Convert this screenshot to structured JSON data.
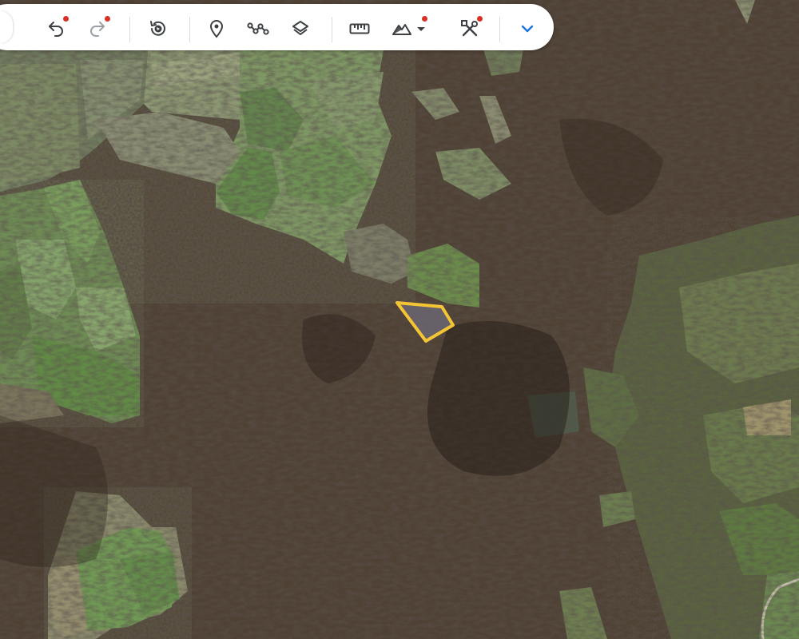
{
  "map": {
    "view": "satellite",
    "parcel_outline_color": "#f3c534",
    "parcel_fill_color": "#6e6a7a"
  },
  "toolbar": {
    "buttons": [
      {
        "name": "undo",
        "icon": "undo-icon",
        "badge": true
      },
      {
        "name": "redo",
        "icon": "redo-icon",
        "badge": true,
        "disabled": true
      },
      {
        "name": "historical-imagery",
        "icon": "history-icon",
        "badge": false
      },
      {
        "name": "add-placemark",
        "icon": "location-pin-icon",
        "badge": false
      },
      {
        "name": "add-path",
        "icon": "path-icon",
        "badge": false
      },
      {
        "name": "layers",
        "icon": "layers-icon",
        "badge": false
      },
      {
        "name": "measure",
        "icon": "ruler-icon",
        "badge": false
      },
      {
        "name": "terrain-options",
        "icon": "terrain-icon",
        "badge": true
      },
      {
        "name": "tools",
        "icon": "tools-icon",
        "badge": true
      },
      {
        "name": "collapse-toolbar",
        "icon": "chevron-down-icon",
        "badge": false
      }
    ],
    "icon_color": "#3c4043",
    "disabled_color": "#9aa0a6",
    "accent_color": "#1a73e8",
    "badge_color": "#d93025"
  }
}
